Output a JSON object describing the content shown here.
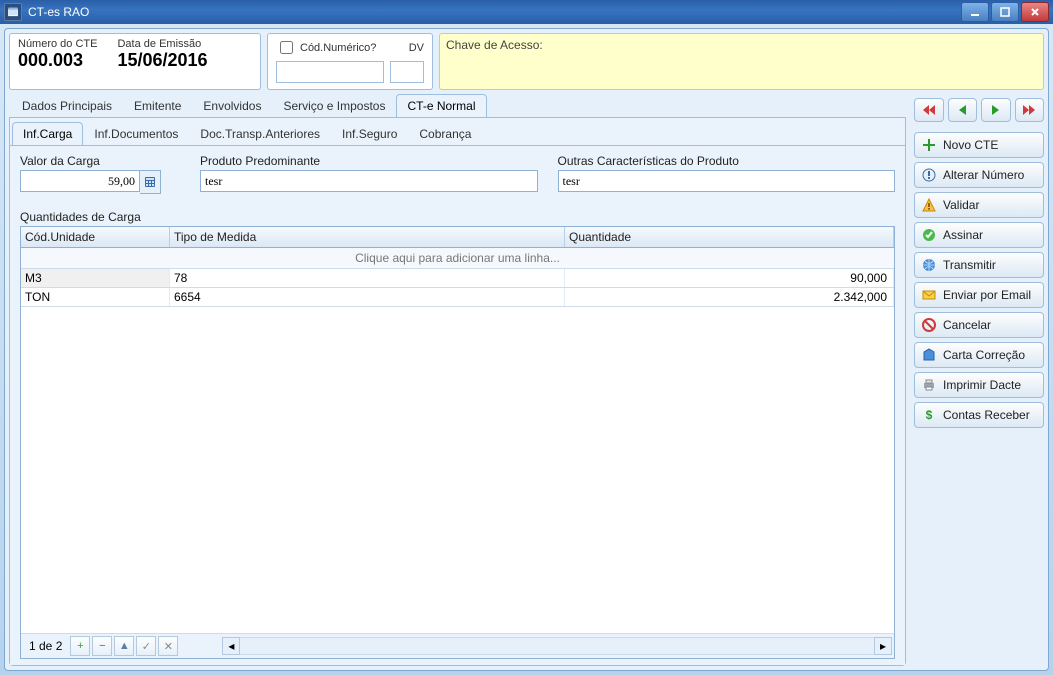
{
  "window": {
    "title": "CT-es RAO"
  },
  "header": {
    "numero_label": "Número do CTE",
    "numero_value": "000.003",
    "data_label": "Data de Emissão",
    "data_value": "15/06/2016",
    "cod_num_label": "Cód.Numérico?",
    "cod_num_value": "",
    "dv_label": "DV",
    "dv_value": "",
    "chave_label": "Chave de Acesso:",
    "chave_value": ""
  },
  "tabs_main": [
    "Dados Principais",
    "Emitente",
    "Envolvidos",
    "Serviço e Impostos",
    "CT-e Normal"
  ],
  "tabs_main_active": 4,
  "tabs_sub": [
    "Inf.Carga",
    "Inf.Documentos",
    "Doc.Transp.Anteriores",
    "Inf.Seguro",
    "Cobrança"
  ],
  "tabs_sub_active": 0,
  "form": {
    "valor_label": "Valor da Carga",
    "valor_value": "59,00",
    "produto_label": "Produto Predominante",
    "produto_value": "tesr",
    "outras_label": "Outras Características do Produto",
    "outras_value": "tesr"
  },
  "grid": {
    "title": "Quantidades de Carga",
    "headers": [
      "Cód.Unidade",
      "Tipo de Medida",
      "Quantidade"
    ],
    "add_placeholder": "Clique aqui para adicionar uma linha...",
    "rows": [
      {
        "unidade": "M3",
        "tipo": "78",
        "quantidade": "90,000"
      },
      {
        "unidade": "TON",
        "tipo": "6654",
        "quantidade": "2.342,000"
      }
    ],
    "footer_count": "1 de 2"
  },
  "side": {
    "buttons": [
      {
        "icon": "plus-green",
        "label": "Novo CTE"
      },
      {
        "icon": "exclaim-blue",
        "label": "Alterar Número"
      },
      {
        "icon": "warn",
        "label": "Validar"
      },
      {
        "icon": "check-green",
        "label": "Assinar"
      },
      {
        "icon": "globe",
        "label": "Transmitir"
      },
      {
        "icon": "mail",
        "label": "Enviar por Email"
      },
      {
        "icon": "cancel",
        "label": "Cancelar"
      },
      {
        "icon": "doc",
        "label": "Carta Correção"
      },
      {
        "icon": "printer",
        "label": "Imprimir Dacte"
      },
      {
        "icon": "money",
        "label": "Contas Receber"
      }
    ]
  }
}
